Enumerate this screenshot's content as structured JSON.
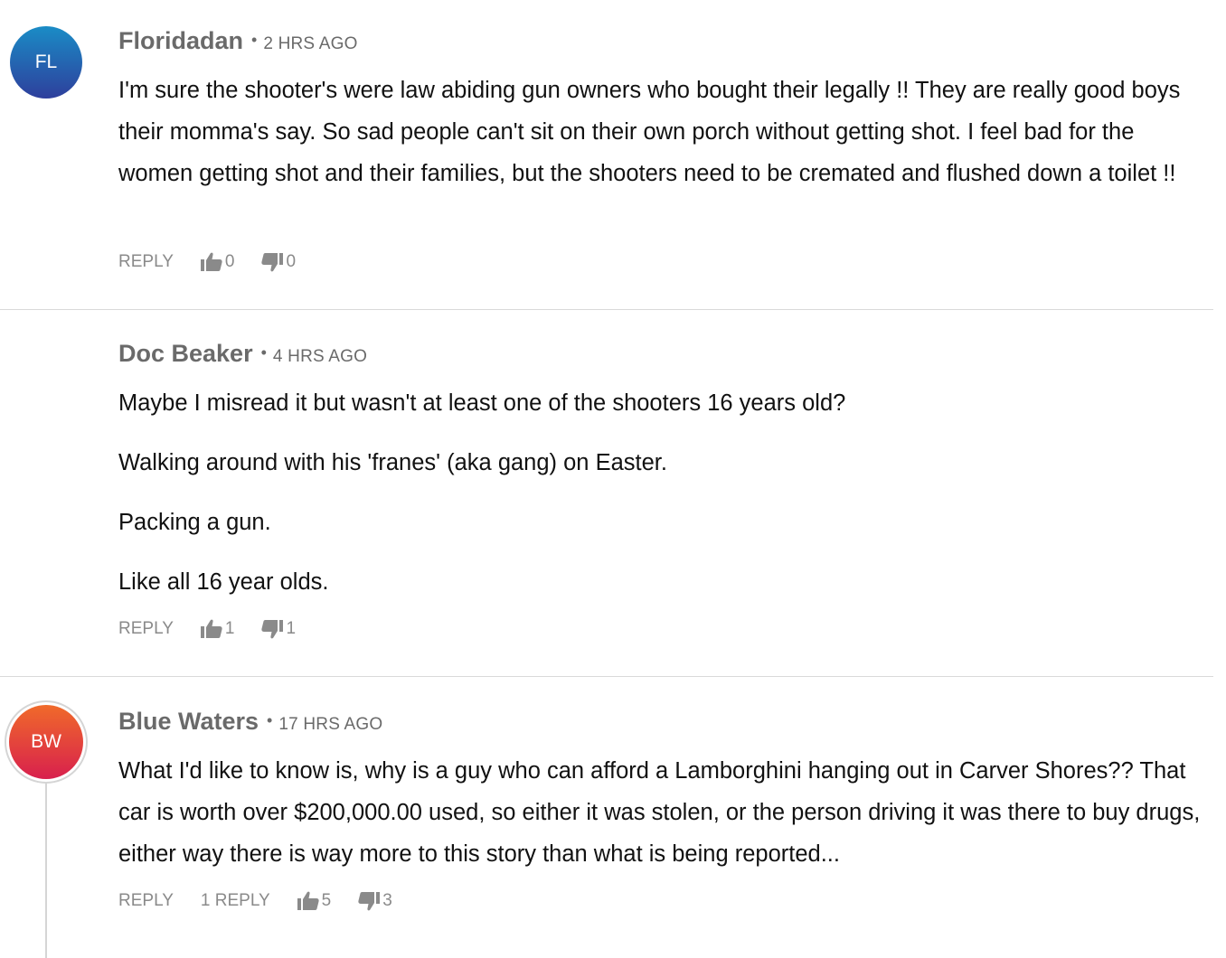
{
  "comments": [
    {
      "avatar": {
        "initials": "FL",
        "colors": [
          "#1a8cc6",
          "#2e3f9c"
        ]
      },
      "author": "Floridadan",
      "time": "2 HRS AGO",
      "paragraphs": [
        "I'm sure the shooter's were law abiding gun owners who bought their legally !! They are really good boys their momma's say. So sad people can't sit on their own porch without getting shot. I feel bad for the women getting shot and their families, but the shooters need to be cremated and flushed down a toilet !!"
      ],
      "reply_label": "REPLY",
      "upvotes": "0",
      "downvotes": "0"
    },
    {
      "author": "Doc Beaker",
      "time": "4 HRS AGO",
      "paragraphs": [
        "Maybe I misread it but wasn't at least one of the shooters 16 years old?",
        "Walking around with his 'franes' (aka gang) on Easter.",
        "Packing a gun.",
        "Like all 16 year olds."
      ],
      "reply_label": "REPLY",
      "upvotes": "1",
      "downvotes": "1"
    },
    {
      "avatar": {
        "initials": "BW",
        "colors": [
          "#f06a2a",
          "#d8204d"
        ]
      },
      "author": "Blue Waters",
      "time": "17 HRS AGO",
      "paragraphs": [
        "What I'd like to know is, why is a guy who can afford a Lamborghini hanging out in Carver Shores?? That car is worth over $200,000.00 used, so either it was stolen, or the person driving it was there to buy drugs, either way there is way more to this story than what is being reported..."
      ],
      "reply_label": "REPLY",
      "replies_label": "1 REPLY",
      "upvotes": "5",
      "downvotes": "3"
    }
  ],
  "icons": {
    "upvote": "thumbs-up-icon",
    "downvote": "thumbs-down-icon"
  },
  "colors": {
    "meta_text": "#6a6a6a",
    "action_text": "#8a8a8a",
    "divider": "#d9d9d9"
  }
}
